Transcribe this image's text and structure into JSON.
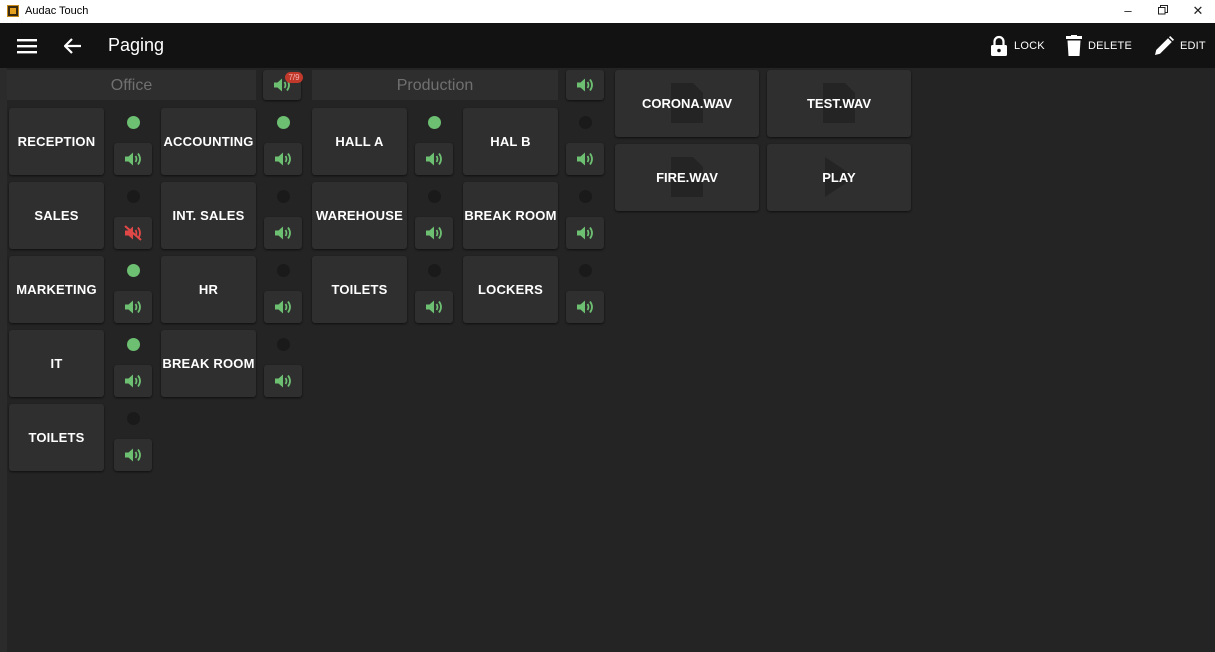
{
  "window": {
    "title": "Audac Touch"
  },
  "toolbar": {
    "title": "Paging",
    "lock_label": "LOCK",
    "delete_label": "DELETE",
    "edit_label": "EDIT"
  },
  "groups": [
    {
      "name": "Office",
      "badge": "7/9"
    },
    {
      "name": "Production"
    }
  ],
  "zones": {
    "reception": {
      "label": "RECEPTION",
      "active": true,
      "muted": false
    },
    "accounting": {
      "label": "ACCOUNTING",
      "active": true,
      "muted": false
    },
    "hall_a": {
      "label": "HALL A",
      "active": true,
      "muted": false
    },
    "hal_b": {
      "label": "HAL B",
      "active": false,
      "muted": false
    },
    "sales": {
      "label": "SALES",
      "active": false,
      "muted": true
    },
    "int_sales": {
      "label": "INT. SALES",
      "active": false,
      "muted": false
    },
    "warehouse": {
      "label": "WAREHOUSE",
      "active": false,
      "muted": false
    },
    "break_room_prod": {
      "label": "BREAK ROOM",
      "active": false,
      "muted": false
    },
    "marketing": {
      "label": "MARKETING",
      "active": true,
      "muted": false
    },
    "hr": {
      "label": "HR",
      "active": false,
      "muted": false
    },
    "toilets_prod": {
      "label": "TOILETS",
      "active": false,
      "muted": false
    },
    "lockers": {
      "label": "LOCKERS",
      "active": false,
      "muted": false
    },
    "it": {
      "label": "IT",
      "active": true,
      "muted": false
    },
    "break_room_office": {
      "label": "BREAK ROOM",
      "active": false,
      "muted": false
    },
    "toilets_office": {
      "label": "TOILETS",
      "active": false,
      "muted": false
    }
  },
  "files": [
    {
      "label": "CORONA.WAV",
      "icon": "file-icon"
    },
    {
      "label": "TEST.WAV",
      "icon": "file-icon"
    },
    {
      "label": "FIRE.WAV",
      "icon": "file-icon"
    },
    {
      "label": "PLAY",
      "icon": "play-icon"
    }
  ],
  "colors": {
    "active": "#6dbf72",
    "muted": "#e04848",
    "badge": "#c0392b"
  }
}
